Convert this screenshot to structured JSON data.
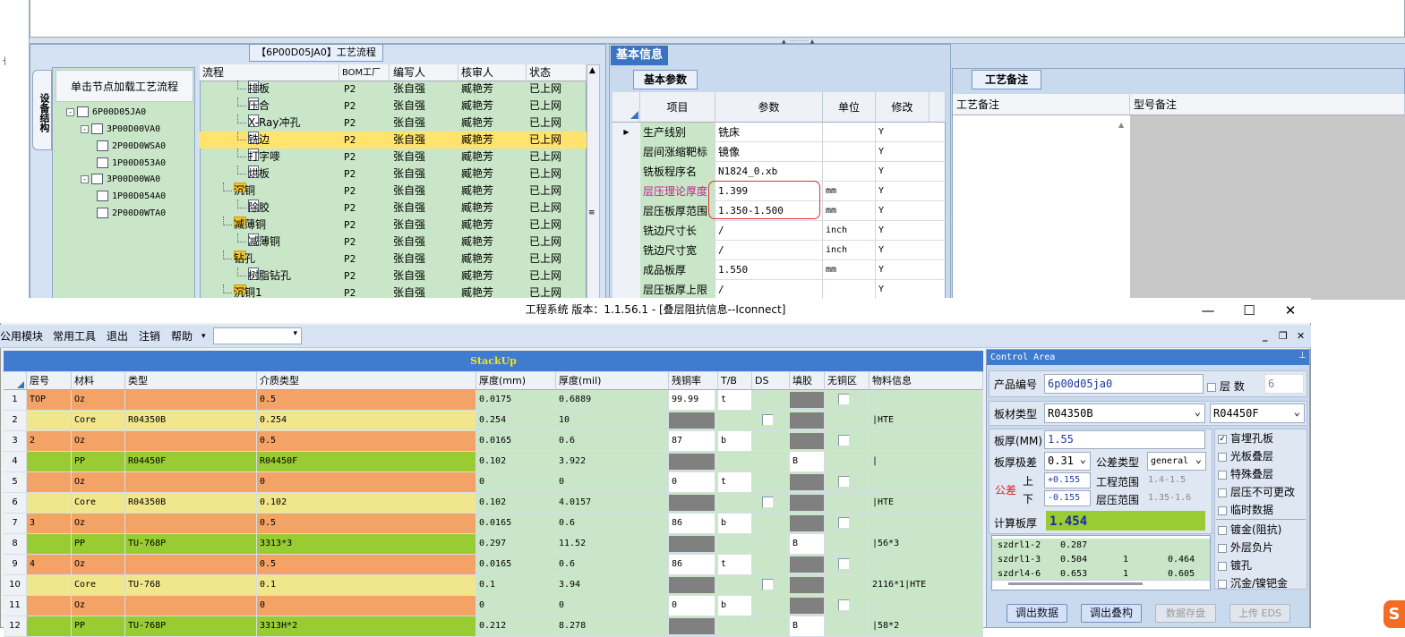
{
  "upper": {
    "process_panel_title": "【6P00D05JA0】工艺流程",
    "device_tab": "设备结构",
    "load_button": "单击节点加载工艺流程",
    "tree": [
      {
        "label": "6P00D05JA0",
        "toggle": "-"
      },
      {
        "label": "3P00D00VA0",
        "toggle": "-"
      },
      {
        "label": "2P00D0WSA0",
        "toggle": ""
      },
      {
        "label": "1P00D053A0",
        "toggle": ""
      },
      {
        "label": "3P00D00WA0",
        "toggle": "-"
      },
      {
        "label": "1P00D054A0",
        "toggle": ""
      },
      {
        "label": "2P00D0WTA0",
        "toggle": ""
      }
    ],
    "grid_headers": [
      "流程",
      "BOM工厂",
      "编写人",
      "核审人",
      "状态"
    ],
    "grid_rows": [
      {
        "name": "排板",
        "bom": "P2",
        "writer": "张自强",
        "reviewer": "臧艳芳",
        "status": "已上网",
        "kind": "doc",
        "indent": 2
      },
      {
        "name": "压合",
        "bom": "P2",
        "writer": "张自强",
        "reviewer": "臧艳芳",
        "status": "已上网",
        "kind": "doc",
        "indent": 2
      },
      {
        "name": "X-Ray冲孔",
        "bom": "P2",
        "writer": "张自强",
        "reviewer": "臧艳芳",
        "status": "已上网",
        "kind": "doc",
        "indent": 2
      },
      {
        "name": "铣边",
        "bom": "P2",
        "writer": "张自强",
        "reviewer": "臧艳芳",
        "status": "已上网",
        "kind": "doc",
        "indent": 2,
        "selected": true
      },
      {
        "name": "打字嘜",
        "bom": "P2",
        "writer": "张自强",
        "reviewer": "臧艳芳",
        "status": "已上网",
        "kind": "doc",
        "indent": 2
      },
      {
        "name": "烘板",
        "bom": "P2",
        "writer": "张自强",
        "reviewer": "臧艳芳",
        "status": "已上网",
        "kind": "doc",
        "indent": 2
      },
      {
        "name": "沉铜",
        "bom": "P2",
        "writer": "张自强",
        "reviewer": "臧艳芳",
        "status": "已上网",
        "kind": "folder",
        "indent": 1
      },
      {
        "name": "除胶",
        "bom": "P2",
        "writer": "张自强",
        "reviewer": "臧艳芳",
        "status": "已上网",
        "kind": "doc",
        "indent": 2
      },
      {
        "name": "减薄铜",
        "bom": "P2",
        "writer": "张自强",
        "reviewer": "臧艳芳",
        "status": "已上网",
        "kind": "folder",
        "indent": 1
      },
      {
        "name": "减薄铜",
        "bom": "P2",
        "writer": "张自强",
        "reviewer": "臧艳芳",
        "status": "已上网",
        "kind": "doc",
        "indent": 2
      },
      {
        "name": "钻孔",
        "bom": "P2",
        "writer": "张自强",
        "reviewer": "臧艳芳",
        "status": "已上网",
        "kind": "folder",
        "indent": 1
      },
      {
        "name": "树脂钻孔",
        "bom": "P2",
        "writer": "张自强",
        "reviewer": "臧艳芳",
        "status": "已上网",
        "kind": "doc",
        "indent": 2
      },
      {
        "name": "沉铜1",
        "bom": "P2",
        "writer": "张自强",
        "reviewer": "臧艳芳",
        "status": "已上网",
        "kind": "folder",
        "indent": 1
      }
    ],
    "basic_info_tab": "基本信息",
    "basic_params_tab": "基本参数",
    "params_headers": [
      "项目",
      "参数",
      "单位",
      "修改"
    ],
    "params": [
      {
        "item": "生产线别",
        "value": "铣床",
        "unit": "",
        "mod": "Y",
        "current": true
      },
      {
        "item": "层间涨缩靶标",
        "value": "镜像",
        "unit": "",
        "mod": "Y"
      },
      {
        "item": "铣板程序名",
        "value": "N1824_0.xb",
        "unit": "",
        "mod": "Y"
      },
      {
        "item": "层压理论厚度",
        "value": "1.399",
        "unit": "mm",
        "mod": "Y",
        "highlight": true
      },
      {
        "item": "层压板厚范围",
        "value": "1.350-1.500",
        "unit": "mm",
        "mod": "Y"
      },
      {
        "item": "铣边尺寸长",
        "value": "/",
        "unit": "inch",
        "mod": "Y"
      },
      {
        "item": "铣边尺寸宽",
        "value": "/",
        "unit": "inch",
        "mod": "Y"
      },
      {
        "item": "成品板厚",
        "value": "1.550",
        "unit": "mm",
        "mod": "Y"
      },
      {
        "item": "层压板厚上限",
        "value": "/",
        "unit": "",
        "mod": "Y"
      }
    ],
    "notes_tab": "工艺备注",
    "notes_headers": [
      "工艺备注",
      "型号备注"
    ]
  },
  "window": {
    "title": "工程系统   版本：1.1.56.1 - [叠层阻抗信息--Iconnect]",
    "minimize": "—",
    "maximize": "☐",
    "close": "✕",
    "menu": [
      "公用模块",
      "常用工具",
      "退出",
      "注销",
      "帮助"
    ],
    "menu_more": "▾",
    "mdi": [
      "_",
      "❐",
      "✕"
    ]
  },
  "stackup": {
    "title": "StackUp",
    "headers": [
      "层号",
      "材料",
      "类型",
      "介质类型",
      "厚度(mm)",
      "厚度(mil)",
      "残铜率",
      "T/B",
      "DS",
      "填胶",
      "无铜区",
      "物料信息"
    ],
    "rows": [
      {
        "n": "1",
        "layer": "TOP",
        "mat": "Oz",
        "type": "",
        "diel": "0.5",
        "mm": "0.0175",
        "mil": "0.6889",
        "res": "99.99",
        "tb": "t",
        "info": "",
        "color": "o",
        "kind": "cu"
      },
      {
        "n": "2",
        "layer": "",
        "mat": "Core",
        "type": "R04350B",
        "diel": "0.254",
        "mm": "0.254",
        "mil": "10",
        "res": "",
        "tb": "",
        "info": "|HTE",
        "color": "y",
        "kind": "core"
      },
      {
        "n": "3",
        "layer": "2",
        "mat": "Oz",
        "type": "",
        "diel": "0.5",
        "mm": "0.0165",
        "mil": "0.6",
        "res": "87",
        "tb": "b",
        "info": "",
        "color": "o",
        "kind": "cu"
      },
      {
        "n": "4",
        "layer": "",
        "mat": "PP",
        "type": "R04450F",
        "diel": "R04450F",
        "mm": "0.102",
        "mil": "3.922",
        "res": "",
        "tb": "",
        "fill": "B",
        "info": "|",
        "color": "g",
        "kind": "pp"
      },
      {
        "n": "5",
        "layer": "",
        "mat": "Oz",
        "type": "",
        "diel": "0",
        "mm": "0",
        "mil": "0",
        "res": "0",
        "tb": "t",
        "info": "",
        "color": "o",
        "kind": "cu"
      },
      {
        "n": "6",
        "layer": "",
        "mat": "Core",
        "type": "R04350B",
        "diel": "0.102",
        "mm": "0.102",
        "mil": "4.0157",
        "res": "",
        "tb": "",
        "info": "|HTE",
        "color": "y",
        "kind": "core"
      },
      {
        "n": "7",
        "layer": "3",
        "mat": "Oz",
        "type": "",
        "diel": "0.5",
        "mm": "0.0165",
        "mil": "0.6",
        "res": "86",
        "tb": "b",
        "info": "",
        "color": "o",
        "kind": "cu"
      },
      {
        "n": "8",
        "layer": "",
        "mat": "PP",
        "type": "TU-768P",
        "diel": "3313*3",
        "mm": "0.297",
        "mil": "11.52",
        "res": "",
        "tb": "",
        "fill": "B",
        "info": "|56*3",
        "color": "g",
        "kind": "pp"
      },
      {
        "n": "9",
        "layer": "4",
        "mat": "Oz",
        "type": "",
        "diel": "0.5",
        "mm": "0.0165",
        "mil": "0.6",
        "res": "86",
        "tb": "t",
        "info": "",
        "color": "o",
        "kind": "cu"
      },
      {
        "n": "10",
        "layer": "",
        "mat": "Core",
        "type": "TU-768",
        "diel": "0.1",
        "mm": "0.1",
        "mil": "3.94",
        "res": "",
        "tb": "",
        "info": "2116*1|HTE",
        "color": "y",
        "kind": "core"
      },
      {
        "n": "11",
        "layer": "",
        "mat": "Oz",
        "type": "",
        "diel": "0",
        "mm": "0",
        "mil": "0",
        "res": "0",
        "tb": "b",
        "info": "",
        "color": "o",
        "kind": "cu"
      },
      {
        "n": "12",
        "layer": "",
        "mat": "PP",
        "type": "TU-768P",
        "diel": "3313H*2",
        "mm": "0.212",
        "mil": "8.278",
        "res": "",
        "tb": "",
        "fill": "B",
        "info": "|58*2",
        "color": "g",
        "kind": "pp"
      }
    ]
  },
  "control": {
    "title": "Control Area",
    "pin": "📌",
    "product_label": "产品编号",
    "product_value": "6p00d05ja0",
    "layers_label": "层 数",
    "layers_value": "6",
    "board_type_label": "板材类型",
    "board_type_value": "R04350B",
    "board_type2_value": "R04450F",
    "thickness_label": "板厚(MM)",
    "thickness_value": "1.55",
    "tol_grade_label": "板厚极差",
    "tol_grade_value": "0.31",
    "tol_type_label": "公差类型",
    "tol_type_value": "general",
    "tol_label": "公差",
    "upper_label": "上",
    "lower_label": "下",
    "upper_value": "+0.155",
    "lower_value": "-0.155",
    "eng_range_label": "工程范围",
    "eng_range_value": "1.4-1.5",
    "press_range_label": "层压范围",
    "press_range_value": "1.35-1.6",
    "calc_label": "计算板厚",
    "calc_value": "1.454",
    "options": [
      {
        "label": "盲埋孔板",
        "checked": true
      },
      {
        "label": "光板叠层",
        "checked": false
      },
      {
        "label": "特殊叠层",
        "checked": false
      },
      {
        "label": "层压不可更改",
        "checked": false
      },
      {
        "label": "临时数据",
        "checked": false
      },
      {
        "label": "镀金(阻抗)",
        "checked": false
      },
      {
        "label": "外层负片",
        "checked": false
      },
      {
        "label": "镀孔",
        "checked": false
      },
      {
        "label": "沉金/镍钯金",
        "checked": false
      }
    ],
    "drill": [
      {
        "name": "szdrl1-2",
        "a": "0.287",
        "b": "",
        "c": ""
      },
      {
        "name": "szdrl1-3",
        "a": "0.504",
        "b": "1",
        "c": "0.464"
      },
      {
        "name": "szdrl4-6",
        "a": "0.653",
        "b": "1",
        "c": "0.605"
      }
    ],
    "buttons": [
      {
        "label": "调出数据",
        "enabled": true
      },
      {
        "label": "调出叠构",
        "enabled": true
      },
      {
        "label": "数据存盘",
        "enabled": false
      },
      {
        "label": "上传 EDS",
        "enabled": false
      }
    ]
  },
  "logo_text": "S",
  "colors": {
    "cu": "#f4a367",
    "core": "#f0e68c",
    "pp": "#99cc33",
    "grid_green": "#c9e7c8",
    "title_blue": "#3f7cd0",
    "selected": "#ffe36c",
    "highlight_text": "#c0228a",
    "calc_text": "#1a2aa0"
  }
}
